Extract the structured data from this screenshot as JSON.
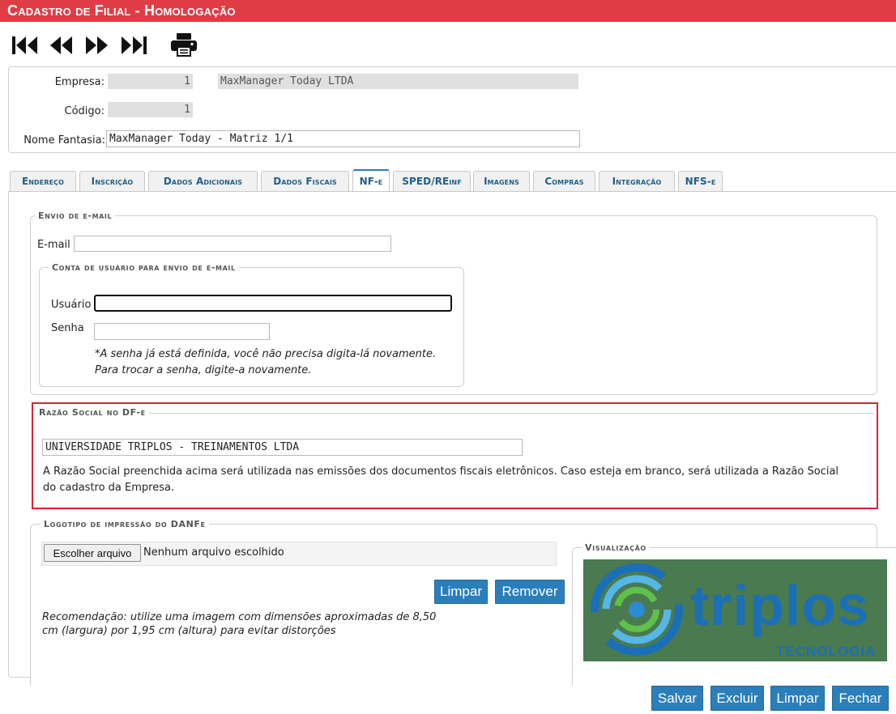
{
  "window": {
    "title": "Cadastro de Filial  - Homologação",
    "title_color": "#e03c45"
  },
  "toolbar": {
    "icons": [
      "first-record-icon",
      "previous-record-icon",
      "next-record-icon",
      "last-record-icon",
      "printer-icon"
    ]
  },
  "header": {
    "empresa_label": "Empresa:",
    "empresa_code": "1",
    "empresa_name": "MaxManager Today LTDA",
    "codigo_label": "Código:",
    "codigo_value": "1",
    "nome_fantasia_label": "Nome Fantasia:",
    "nome_fantasia_value": "MaxManager Today - Matriz 1/1"
  },
  "tabs": [
    {
      "label": "Endereço"
    },
    {
      "label": "Inscrição"
    },
    {
      "label": "Dados Adicionais"
    },
    {
      "label": "Dados Fiscais"
    },
    {
      "label": "NF-e",
      "active": true
    },
    {
      "label": "SPED/REinf"
    },
    {
      "label": "Imagens"
    },
    {
      "label": "Compras"
    },
    {
      "label": "Integração"
    },
    {
      "label": "NFS-e"
    }
  ],
  "email_section": {
    "legend": "Envio de e-mail",
    "email_label": "E-mail",
    "email_value": "",
    "account": {
      "legend": "Conta de usuário para envio de e-mail",
      "usuario_label": "Usuário",
      "usuario_value": "",
      "senha_label": "Senha",
      "senha_value": "",
      "note_line1": "*A senha já está definida, você não precisa digita-lá novamente.",
      "note_line2": "Para trocar a senha, digite-a novamente."
    }
  },
  "razao_section": {
    "legend": "Razão Social no DF-e",
    "value": "UNIVERSIDADE TRIPLOS - TREINAMENTOS LTDA",
    "help_line1": "A Razão Social preenchida acima será utilizada nas emissões dos documentos fiscais eletrônicos. Caso esteja em branco, será utilizada a Razão Social",
    "help_line2": "do cadastro da Empresa.",
    "highlight_color": "#d9232f"
  },
  "logo_section": {
    "legend": "Logotipo de impressão do DANFe",
    "choose_file_label": "Escolher arquivo",
    "no_file_label": "Nenhum arquivo escolhido",
    "limpar_label": "Limpar",
    "remover_label": "Remover",
    "recommendation_line1": "Recomendação: utilize uma imagem com dimensões aproximadas de 8,50",
    "recommendation_line2": "cm (largura) por 1,95 cm (altura) para evitar distorções",
    "preview_legend": "Visualização",
    "preview": {
      "brand": "triplos",
      "sub": "TECNOLOGIA",
      "bg_color": "#4a7a4f",
      "brand_color": "#1a6fb8"
    }
  },
  "footer": {
    "salvar": "Salvar",
    "excluir": "Excluir",
    "limpar": "Limpar",
    "fechar": "Fechar",
    "button_color": "#2a7fba"
  }
}
